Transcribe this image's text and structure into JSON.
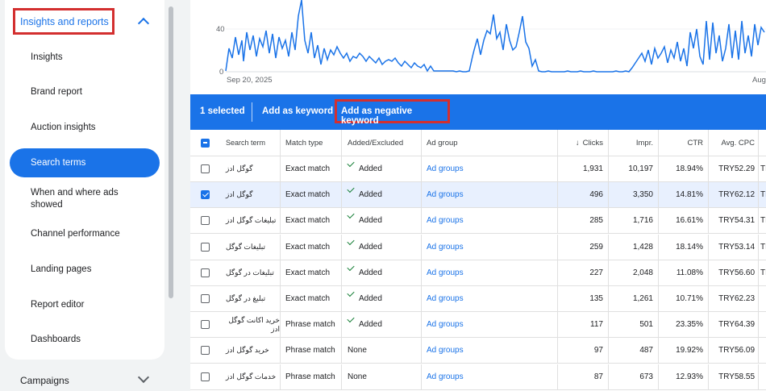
{
  "sidebar": {
    "section_title": "Insights and reports",
    "items": [
      {
        "label": "Insights"
      },
      {
        "label": "Brand report"
      },
      {
        "label": "Auction insights"
      },
      {
        "label": "Search terms"
      },
      {
        "label": "When and where ads showed"
      },
      {
        "label": "Channel performance"
      },
      {
        "label": "Landing pages"
      },
      {
        "label": "Report editor"
      },
      {
        "label": "Dashboards"
      }
    ],
    "campaigns_label": "Campaigns"
  },
  "chart": {
    "y_ticks": [
      "40",
      "0"
    ],
    "x_start_label": "Sep 20, 2025",
    "x_end_label": "Aug",
    "line_color": "#1a73e8"
  },
  "selection_bar": {
    "count_text": "1 selected",
    "add_keyword": "Add as keyword",
    "add_negative": "Add as negative keyword"
  },
  "table": {
    "headers": {
      "term": "Search term",
      "match": "Match type",
      "added": "Added/Excluded",
      "adgroup": "Ad group",
      "clicks": "Clicks",
      "impr": "Impr.",
      "ctr": "CTR",
      "cpc": "Avg. CPC",
      "sort_icon": "arrow-down-icon"
    },
    "rows": [
      {
        "term": "گوگل ادز",
        "match": "Exact match",
        "added": "Added",
        "adgroup": "Ad groups",
        "clicks": "1,931",
        "impr": "10,197",
        "ctr": "18.94%",
        "cpc": "TRY52.29",
        "extra": "TR",
        "checked": false
      },
      {
        "term": "گوگل ادز",
        "match": "Exact match",
        "added": "Added",
        "adgroup": "Ad groups",
        "clicks": "496",
        "impr": "3,350",
        "ctr": "14.81%",
        "cpc": "TRY62.12",
        "extra": "TR",
        "checked": true
      },
      {
        "term": "تبلیغات گوگل ادز",
        "match": "Exact match",
        "added": "Added",
        "adgroup": "Ad groups",
        "clicks": "285",
        "impr": "1,716",
        "ctr": "16.61%",
        "cpc": "TRY54.31",
        "extra": "TR",
        "checked": false
      },
      {
        "term": "تبلیغات گوگل",
        "match": "Exact match",
        "added": "Added",
        "adgroup": "Ad groups",
        "clicks": "259",
        "impr": "1,428",
        "ctr": "18.14%",
        "cpc": "TRY53.14",
        "extra": "TR",
        "checked": false
      },
      {
        "term": "تبلیغات در گوگل",
        "match": "Exact match",
        "added": "Added",
        "adgroup": "Ad groups",
        "clicks": "227",
        "impr": "2,048",
        "ctr": "11.08%",
        "cpc": "TRY56.60",
        "extra": "TR",
        "checked": false
      },
      {
        "term": "تبلیغ در گوگل",
        "match": "Exact match",
        "added": "Added",
        "adgroup": "Ad groups",
        "clicks": "135",
        "impr": "1,261",
        "ctr": "10.71%",
        "cpc": "TRY62.23",
        "extra": "",
        "checked": false
      },
      {
        "term": "خرید اکانت گوگل ادز",
        "match": "Phrase match",
        "added": "Added",
        "adgroup": "Ad groups",
        "clicks": "117",
        "impr": "501",
        "ctr": "23.35%",
        "cpc": "TRY64.39",
        "extra": "",
        "checked": false
      },
      {
        "term": "خرید گوگل ادز",
        "match": "Phrase match",
        "added": "None",
        "adgroup": "Ad groups",
        "clicks": "97",
        "impr": "487",
        "ctr": "19.92%",
        "cpc": "TRY56.09",
        "extra": "",
        "checked": false
      },
      {
        "term": "خدمات گوگل ادز",
        "match": "Phrase match",
        "added": "None",
        "adgroup": "Ad groups",
        "clicks": "87",
        "impr": "673",
        "ctr": "12.93%",
        "cpc": "TRY58.55",
        "extra": "",
        "checked": false
      }
    ]
  }
}
